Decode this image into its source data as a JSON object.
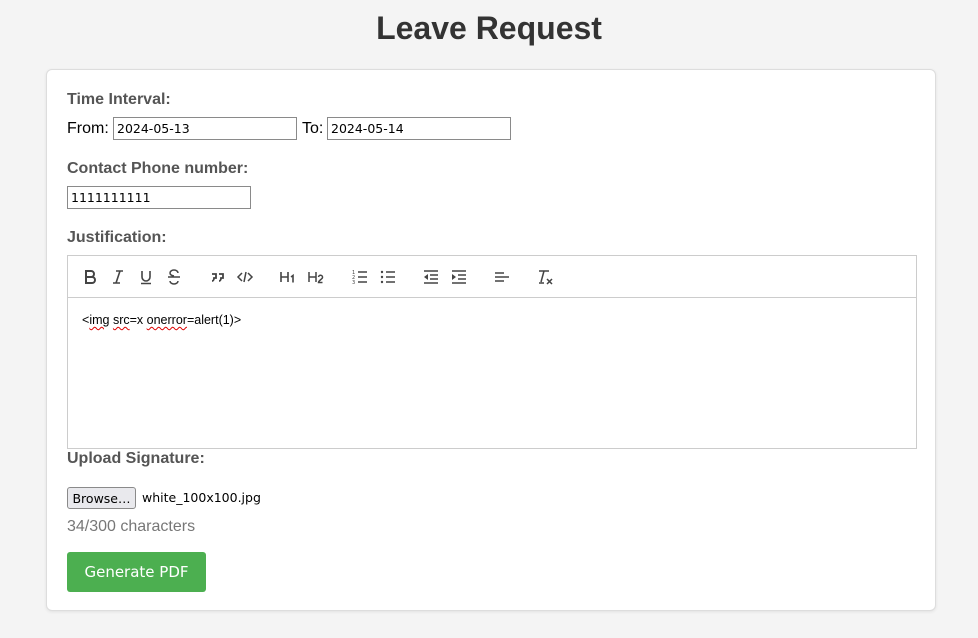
{
  "page": {
    "title": "Leave Request"
  },
  "form": {
    "time_interval_label": "Time Interval:",
    "from_label": "From:",
    "from_value": "2024-05-13",
    "to_label": "To:",
    "to_value": "2024-05-14",
    "phone_label": "Contact Phone number:",
    "phone_value": "1111111111",
    "justification_label": "Justification:",
    "editor": {
      "toolbar": [
        "bold-icon",
        "italic-icon",
        "underline-icon",
        "strikethrough-icon",
        "blockquote-icon",
        "code-icon",
        "heading-1-icon",
        "heading-2-icon",
        "ordered-list-icon",
        "bullet-list-icon",
        "outdent-icon",
        "indent-icon",
        "align-left-icon",
        "clear-format-icon"
      ],
      "content_parts": [
        "<",
        "img",
        " ",
        "src",
        "=x ",
        "onerror",
        "=alert(1)>"
      ]
    },
    "signature_label": "Upload Signature:",
    "browse_label": "Browse…",
    "file_name": "white_100x100.jpg",
    "char_count": "34/300 characters",
    "submit_label": "Generate PDF"
  },
  "colors": {
    "accent": "#4caf50",
    "background": "#f4f4f4",
    "card": "#ffffff"
  }
}
